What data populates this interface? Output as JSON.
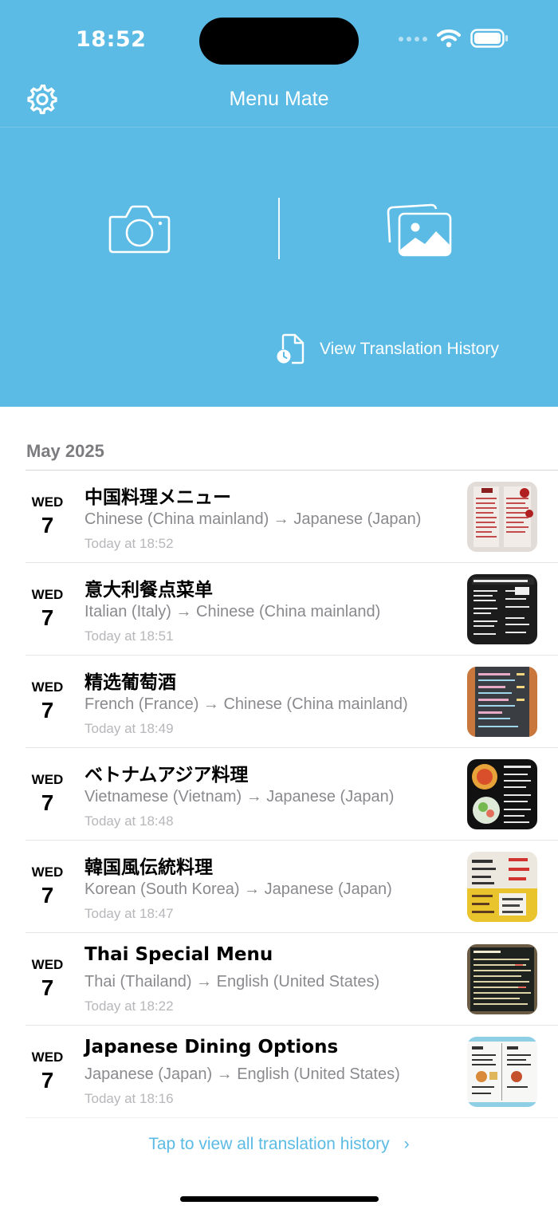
{
  "status_bar": {
    "time": "18:52"
  },
  "app": {
    "title": "Menu Mate"
  },
  "header": {
    "history_label": "View Translation History"
  },
  "section": {
    "month": "May 2025"
  },
  "items": [
    {
      "dow": "WED",
      "day": "7",
      "title": "中国料理メニュー",
      "subtitle": "Chinese (China mainland) → Japanese (Japan)",
      "time": "Today at 18:52"
    },
    {
      "dow": "WED",
      "day": "7",
      "title": "意大利餐点菜单",
      "subtitle": "Italian (Italy) → Chinese (China mainland)",
      "time": "Today at 18:51"
    },
    {
      "dow": "WED",
      "day": "7",
      "title": "精选葡萄酒",
      "subtitle": "French (France) → Chinese (China mainland)",
      "time": "Today at 18:49"
    },
    {
      "dow": "WED",
      "day": "7",
      "title": "ベトナムアジア料理",
      "subtitle": "Vietnamese (Vietnam) → Japanese (Japan)",
      "time": "Today at 18:48"
    },
    {
      "dow": "WED",
      "day": "7",
      "title": "韓国風伝統料理",
      "subtitle": "Korean (South Korea) → Japanese (Japan)",
      "time": "Today at 18:47"
    },
    {
      "dow": "WED",
      "day": "7",
      "title": "Thai Special Menu",
      "subtitle": "Thai (Thailand) → English (United States)",
      "time": "Today at 18:22"
    },
    {
      "dow": "WED",
      "day": "7",
      "title": "Japanese Dining Options",
      "subtitle": "Japanese (Japan) → English (United States)",
      "time": "Today at 18:16"
    }
  ],
  "footer": {
    "link": "Tap to view all translation history",
    "chevron": "›"
  },
  "colors": {
    "accent": "#5bbbe5",
    "secondary_text": "#8a8a8e",
    "tertiary_text": "#b7b7bb"
  },
  "icons": [
    "gear-icon",
    "camera-icon",
    "photo-library-icon",
    "document-history-icon",
    "wifi-icon",
    "battery-icon",
    "chevron-right-icon"
  ]
}
